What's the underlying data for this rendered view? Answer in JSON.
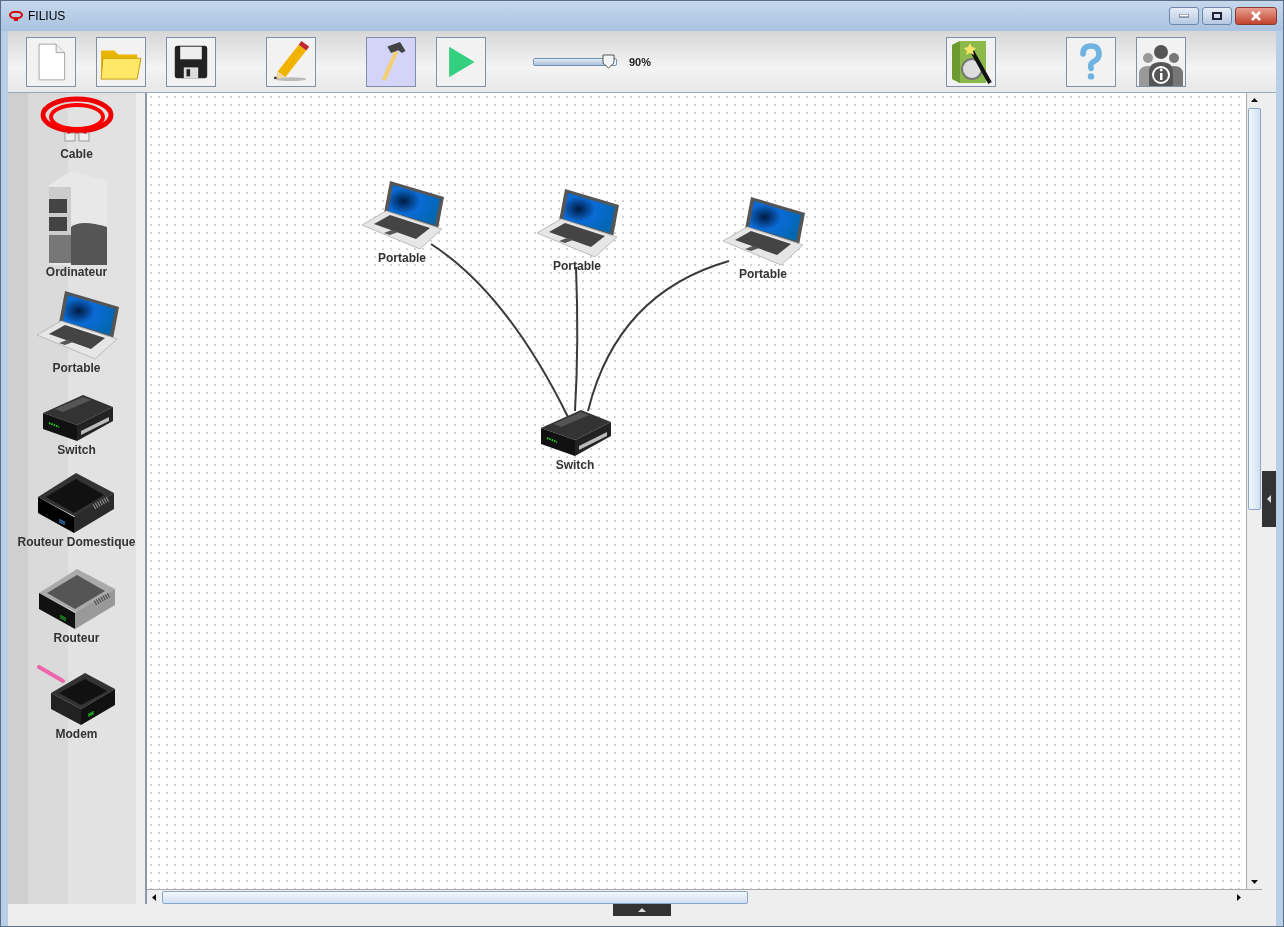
{
  "window": {
    "title": "FILIUS"
  },
  "toolbar": {
    "buttons": [
      {
        "kind": "new",
        "selected": false
      },
      {
        "kind": "open",
        "selected": false
      },
      {
        "kind": "save",
        "selected": false
      },
      {
        "kind": "edit",
        "selected": false
      },
      {
        "kind": "design",
        "selected": true
      },
      {
        "kind": "simulate",
        "selected": false
      },
      {
        "kind": "wizard",
        "selected": false
      },
      {
        "kind": "help",
        "selected": false
      },
      {
        "kind": "info",
        "selected": false
      }
    ],
    "zoom": {
      "level": 0.9,
      "reading": "90%"
    }
  },
  "palette": {
    "items": [
      {
        "kind": "cable",
        "label": "Cable"
      },
      {
        "kind": "computer",
        "label": "Ordinateur"
      },
      {
        "kind": "laptop",
        "label": "Portable"
      },
      {
        "kind": "switch",
        "label": "Switch"
      },
      {
        "kind": "home-router",
        "label": "Routeur Domestique"
      },
      {
        "kind": "router",
        "label": "Routeur"
      },
      {
        "kind": "modem",
        "label": "Modem"
      }
    ]
  },
  "canvas": {
    "nodes": [
      {
        "kind": "laptop",
        "label": "Portable",
        "cabled": true
      },
      {
        "kind": "laptop",
        "label": "Portable",
        "cabled": true
      },
      {
        "kind": "laptop",
        "label": "Portable",
        "cabled": true
      },
      {
        "kind": "switch",
        "label": "Switch"
      }
    ]
  }
}
